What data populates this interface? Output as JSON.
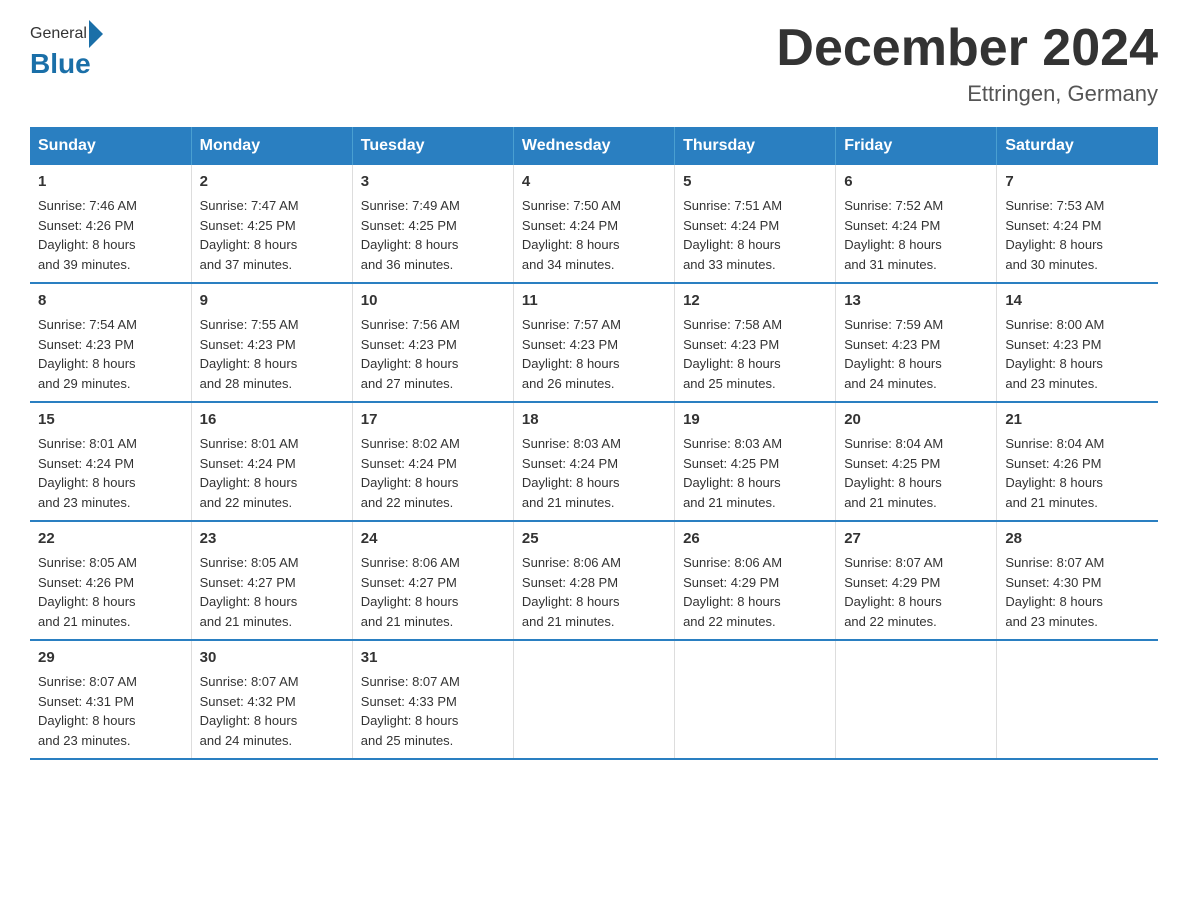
{
  "logo": {
    "general": "General",
    "blue": "Blue"
  },
  "title": "December 2024",
  "location": "Ettringen, Germany",
  "days_of_week": [
    "Sunday",
    "Monday",
    "Tuesday",
    "Wednesday",
    "Thursday",
    "Friday",
    "Saturday"
  ],
  "weeks": [
    [
      {
        "day": "1",
        "sunrise": "7:46 AM",
        "sunset": "4:26 PM",
        "daylight": "8 hours and 39 minutes."
      },
      {
        "day": "2",
        "sunrise": "7:47 AM",
        "sunset": "4:25 PM",
        "daylight": "8 hours and 37 minutes."
      },
      {
        "day": "3",
        "sunrise": "7:49 AM",
        "sunset": "4:25 PM",
        "daylight": "8 hours and 36 minutes."
      },
      {
        "day": "4",
        "sunrise": "7:50 AM",
        "sunset": "4:24 PM",
        "daylight": "8 hours and 34 minutes."
      },
      {
        "day": "5",
        "sunrise": "7:51 AM",
        "sunset": "4:24 PM",
        "daylight": "8 hours and 33 minutes."
      },
      {
        "day": "6",
        "sunrise": "7:52 AM",
        "sunset": "4:24 PM",
        "daylight": "8 hours and 31 minutes."
      },
      {
        "day": "7",
        "sunrise": "7:53 AM",
        "sunset": "4:24 PM",
        "daylight": "8 hours and 30 minutes."
      }
    ],
    [
      {
        "day": "8",
        "sunrise": "7:54 AM",
        "sunset": "4:23 PM",
        "daylight": "8 hours and 29 minutes."
      },
      {
        "day": "9",
        "sunrise": "7:55 AM",
        "sunset": "4:23 PM",
        "daylight": "8 hours and 28 minutes."
      },
      {
        "day": "10",
        "sunrise": "7:56 AM",
        "sunset": "4:23 PM",
        "daylight": "8 hours and 27 minutes."
      },
      {
        "day": "11",
        "sunrise": "7:57 AM",
        "sunset": "4:23 PM",
        "daylight": "8 hours and 26 minutes."
      },
      {
        "day": "12",
        "sunrise": "7:58 AM",
        "sunset": "4:23 PM",
        "daylight": "8 hours and 25 minutes."
      },
      {
        "day": "13",
        "sunrise": "7:59 AM",
        "sunset": "4:23 PM",
        "daylight": "8 hours and 24 minutes."
      },
      {
        "day": "14",
        "sunrise": "8:00 AM",
        "sunset": "4:23 PM",
        "daylight": "8 hours and 23 minutes."
      }
    ],
    [
      {
        "day": "15",
        "sunrise": "8:01 AM",
        "sunset": "4:24 PM",
        "daylight": "8 hours and 23 minutes."
      },
      {
        "day": "16",
        "sunrise": "8:01 AM",
        "sunset": "4:24 PM",
        "daylight": "8 hours and 22 minutes."
      },
      {
        "day": "17",
        "sunrise": "8:02 AM",
        "sunset": "4:24 PM",
        "daylight": "8 hours and 22 minutes."
      },
      {
        "day": "18",
        "sunrise": "8:03 AM",
        "sunset": "4:24 PM",
        "daylight": "8 hours and 21 minutes."
      },
      {
        "day": "19",
        "sunrise": "8:03 AM",
        "sunset": "4:25 PM",
        "daylight": "8 hours and 21 minutes."
      },
      {
        "day": "20",
        "sunrise": "8:04 AM",
        "sunset": "4:25 PM",
        "daylight": "8 hours and 21 minutes."
      },
      {
        "day": "21",
        "sunrise": "8:04 AM",
        "sunset": "4:26 PM",
        "daylight": "8 hours and 21 minutes."
      }
    ],
    [
      {
        "day": "22",
        "sunrise": "8:05 AM",
        "sunset": "4:26 PM",
        "daylight": "8 hours and 21 minutes."
      },
      {
        "day": "23",
        "sunrise": "8:05 AM",
        "sunset": "4:27 PM",
        "daylight": "8 hours and 21 minutes."
      },
      {
        "day": "24",
        "sunrise": "8:06 AM",
        "sunset": "4:27 PM",
        "daylight": "8 hours and 21 minutes."
      },
      {
        "day": "25",
        "sunrise": "8:06 AM",
        "sunset": "4:28 PM",
        "daylight": "8 hours and 21 minutes."
      },
      {
        "day": "26",
        "sunrise": "8:06 AM",
        "sunset": "4:29 PM",
        "daylight": "8 hours and 22 minutes."
      },
      {
        "day": "27",
        "sunrise": "8:07 AM",
        "sunset": "4:29 PM",
        "daylight": "8 hours and 22 minutes."
      },
      {
        "day": "28",
        "sunrise": "8:07 AM",
        "sunset": "4:30 PM",
        "daylight": "8 hours and 23 minutes."
      }
    ],
    [
      {
        "day": "29",
        "sunrise": "8:07 AM",
        "sunset": "4:31 PM",
        "daylight": "8 hours and 23 minutes."
      },
      {
        "day": "30",
        "sunrise": "8:07 AM",
        "sunset": "4:32 PM",
        "daylight": "8 hours and 24 minutes."
      },
      {
        "day": "31",
        "sunrise": "8:07 AM",
        "sunset": "4:33 PM",
        "daylight": "8 hours and 25 minutes."
      },
      null,
      null,
      null,
      null
    ]
  ],
  "labels": {
    "sunrise": "Sunrise:",
    "sunset": "Sunset:",
    "daylight": "Daylight:"
  }
}
